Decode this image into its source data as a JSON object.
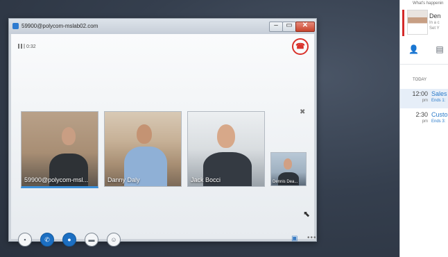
{
  "window": {
    "title": "59900@polycom-mslab02.com",
    "signal_time": "0:32",
    "controls": {
      "minimize": "–",
      "maximize": "▭",
      "close": "✕"
    }
  },
  "participants": [
    {
      "name": "59900@polycom-msl...",
      "active": true
    },
    {
      "name": "Danny Daly"
    },
    {
      "name": "Jack Bocci"
    },
    {
      "name": "Dennis Dea..."
    }
  ],
  "call_controls": [
    {
      "name": "im",
      "glyph": "▪"
    },
    {
      "name": "call",
      "glyph": "✆"
    },
    {
      "name": "video",
      "glyph": "●"
    },
    {
      "name": "present",
      "glyph": "▬"
    },
    {
      "name": "participants",
      "glyph": "☺"
    }
  ],
  "lync_pane": {
    "whats_happening": "What's happenin",
    "me": {
      "name": "Den",
      "status": "In a c",
      "location": "Set Y"
    },
    "section_today": "TODAY",
    "meetings": [
      {
        "time": "12:00",
        "ampm": "pm",
        "title": "Sales",
        "ends": "Ends 1:"
      },
      {
        "time": "2:30",
        "ampm": "pm",
        "title": "Custo",
        "ends": "Ends 3:"
      }
    ]
  },
  "colors": {
    "accent": "#1c6fc2",
    "hangup": "#d9312a",
    "presence_busy": "#d42a2a"
  },
  "icons": {
    "hangup": "hangup-icon",
    "close": "close-icon",
    "cursor": "cursor-icon"
  }
}
